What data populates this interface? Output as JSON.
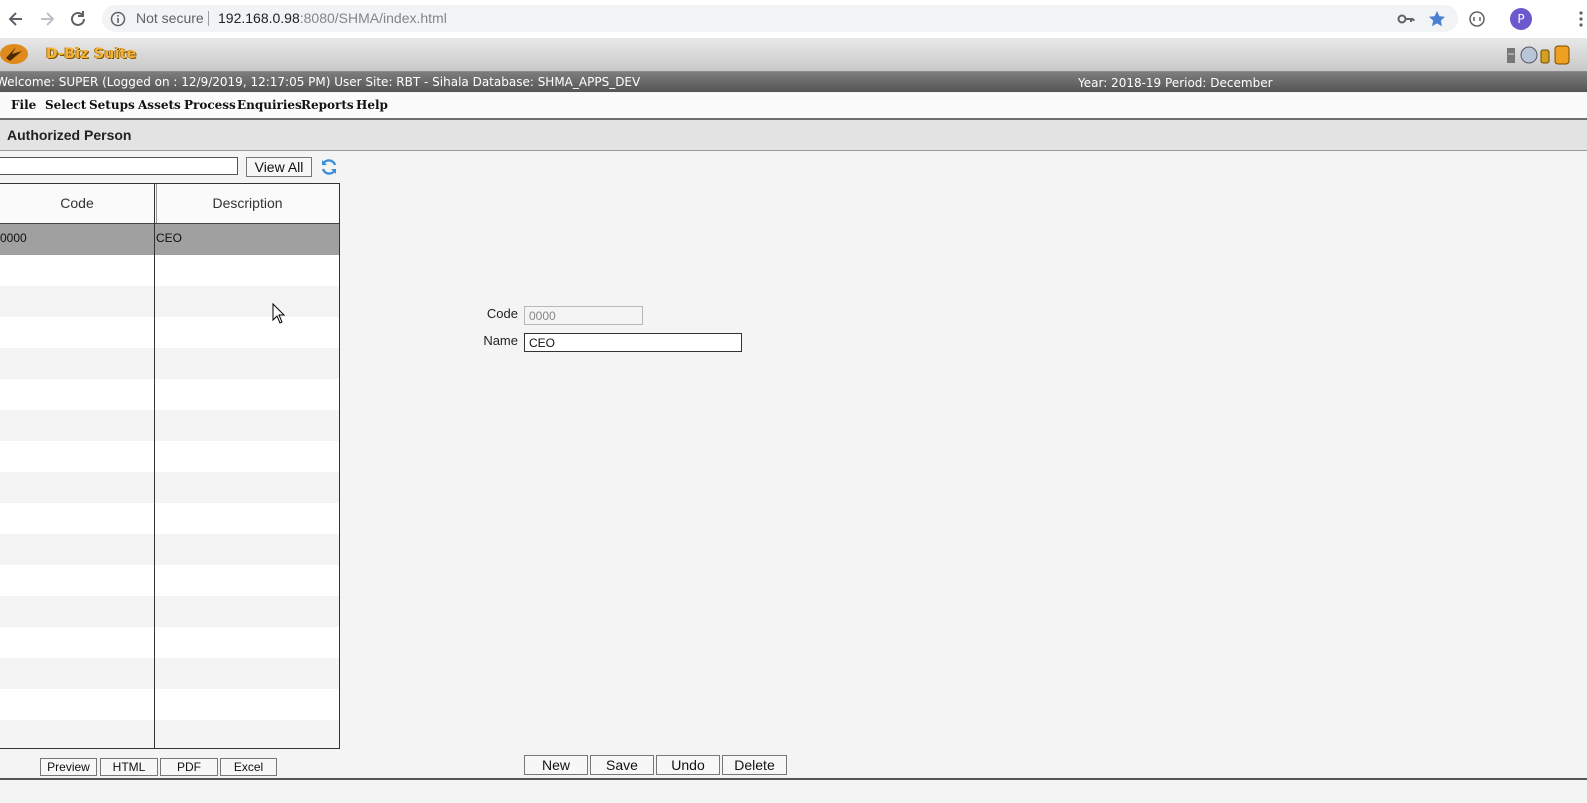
{
  "browser": {
    "security_label": "Not secure",
    "url_host": "192.168.0.98",
    "url_rest": ":8080/SHMA/index.html",
    "avatar_letter": "P"
  },
  "app": {
    "name": "D-Biz Suite",
    "welcome": "Welcome: SUPER (Logged on : 12/9/2019, 12:17:05 PM) User Site: RBT - Sihala Database: SHMA_APPS_DEV",
    "period": "Year: 2018-19 Period: December"
  },
  "menu": [
    "File",
    "Select",
    "Setups",
    "Assets",
    "Process",
    "Enquiries",
    "Reports",
    "Help"
  ],
  "page": {
    "title": "Authorized Person"
  },
  "list": {
    "search_value": "",
    "view_all_label": "View All",
    "headers": {
      "code": "Code",
      "description": "Description"
    },
    "rows": [
      {
        "code": "0000",
        "description": "CEO",
        "selected": true
      }
    ],
    "empty_row_count": 16
  },
  "report_buttons": [
    "Preview",
    "HTML",
    "PDF",
    "Excel"
  ],
  "form": {
    "code_label": "Code",
    "code_value": "0000",
    "name_label": "Name",
    "name_value": "CEO"
  },
  "actions": [
    "New",
    "Save",
    "Undo",
    "Delete"
  ],
  "colors": {
    "selected_row": "#a0a0a0",
    "welcome_bar": "#666666",
    "brand": "#f3b33a"
  }
}
